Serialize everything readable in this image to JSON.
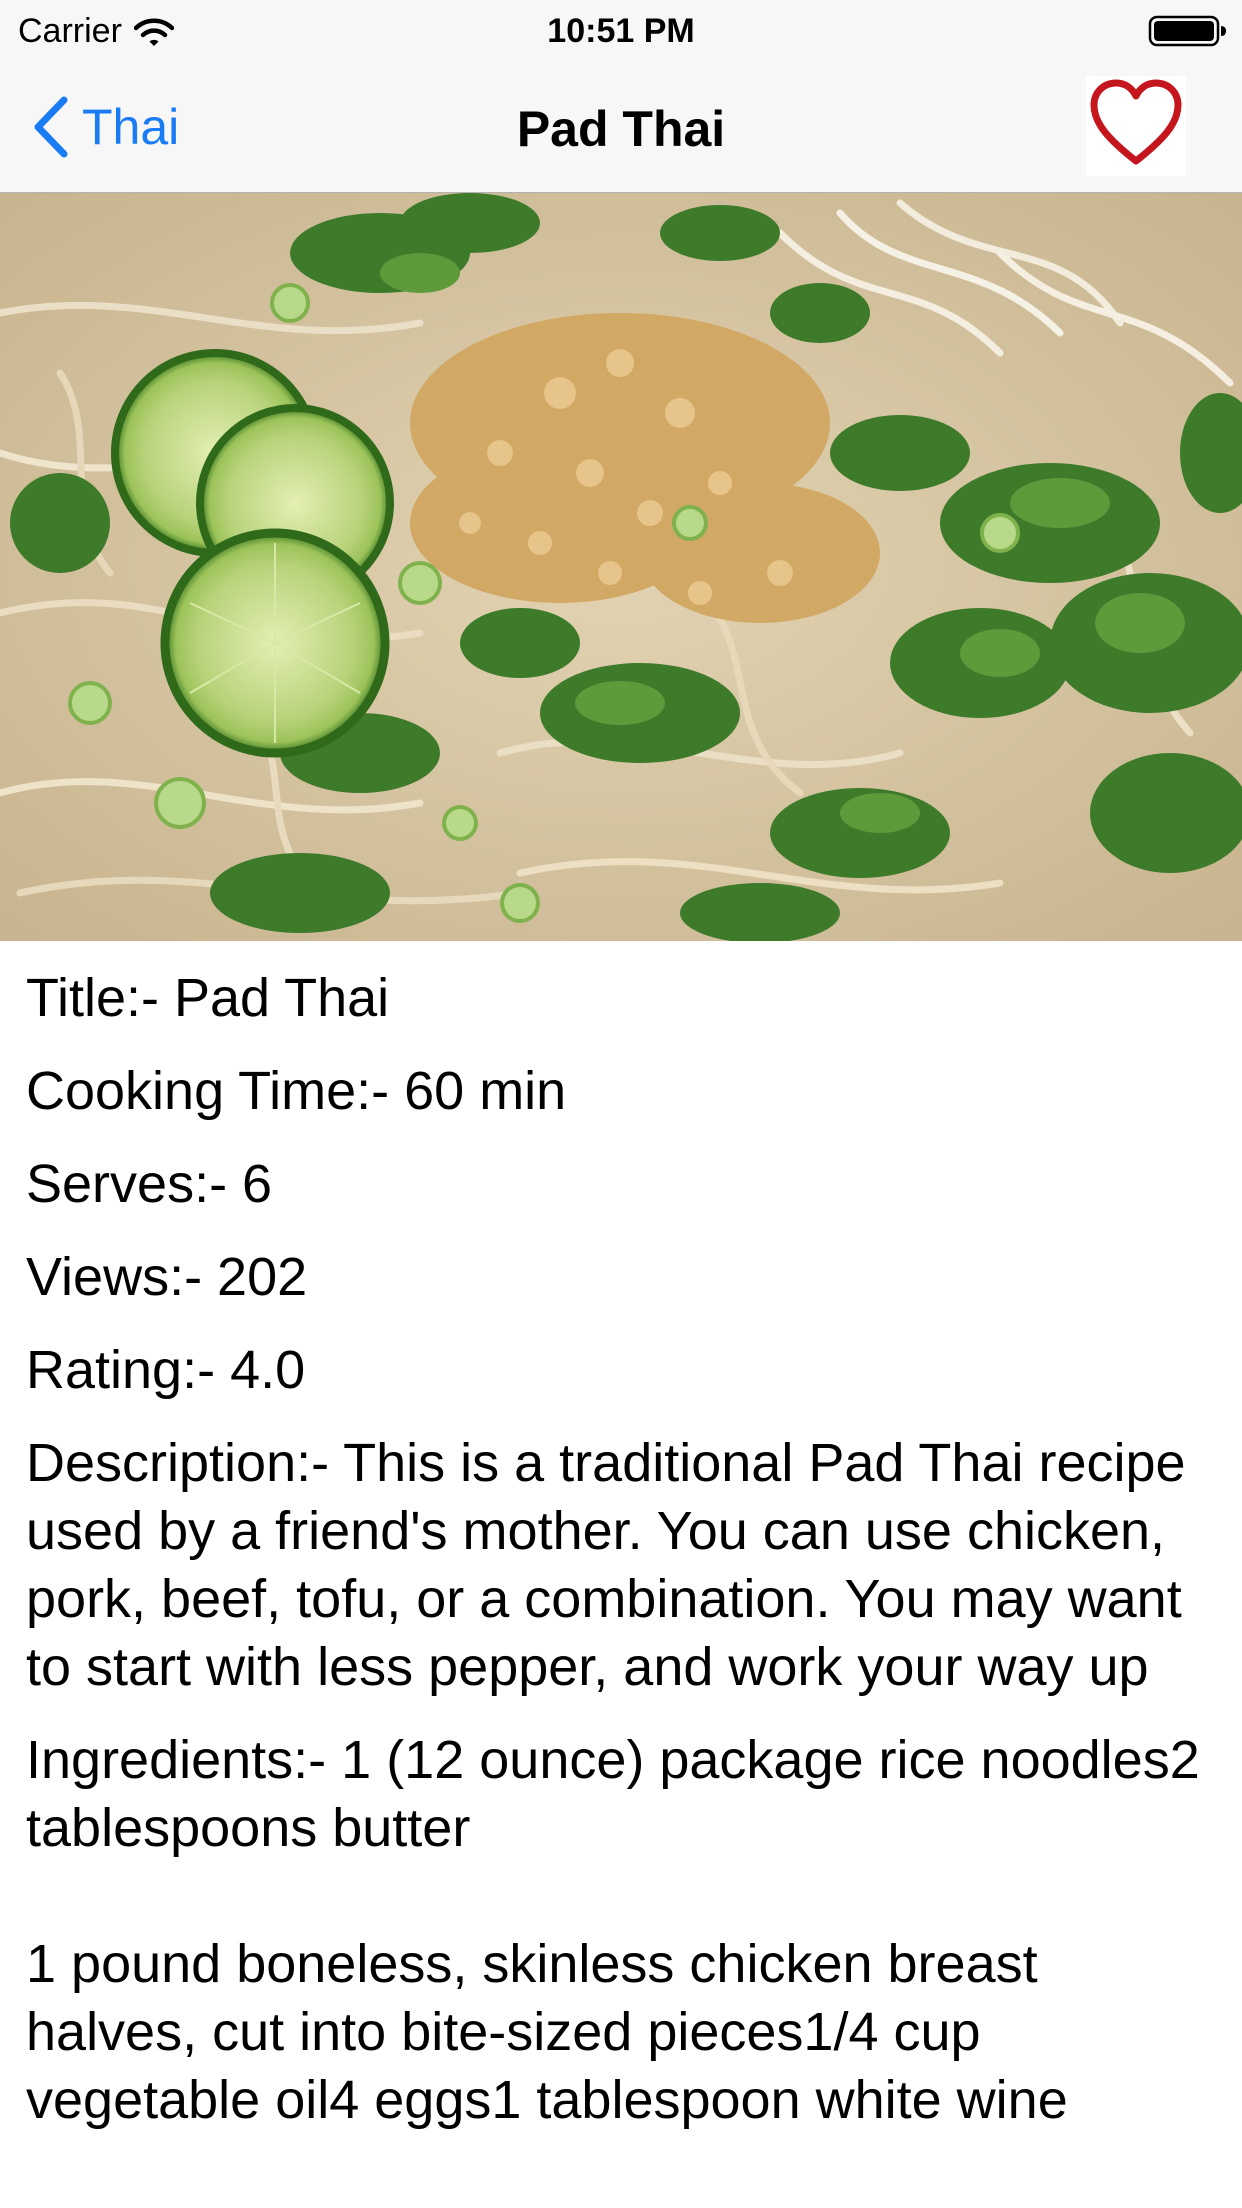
{
  "status_bar": {
    "carrier": "Carrier",
    "time": "10:51 PM"
  },
  "nav": {
    "back_label": "Thai",
    "title": "Pad Thai",
    "favorite_icon": "heart-outline-icon",
    "accent_color": "#1a7cf5",
    "heart_color": "#c4161c"
  },
  "hero_image": {
    "icon": "pad-thai-photo"
  },
  "details": {
    "title": "Title:- Pad Thai",
    "cooking_time": "Cooking Time:- 60 min",
    "serves": "Serves:- 6",
    "views": "Views:- 202",
    "rating": "Rating:- 4.0",
    "description": "Description:- This is a traditional Pad Thai recipe used by a friend's mother. You can use chicken, pork, beef, tofu, or a combination. You may want to start with less pepper, and work your way up",
    "ingredients": "Ingredients:- 1 (12 ounce) package rice noodles2 tablespoons butter\n\n1 pound boneless, skinless chicken breast halves, cut into bite-sized pieces1/4 cup vegetable oil4 eggs1 tablespoon white wine"
  }
}
